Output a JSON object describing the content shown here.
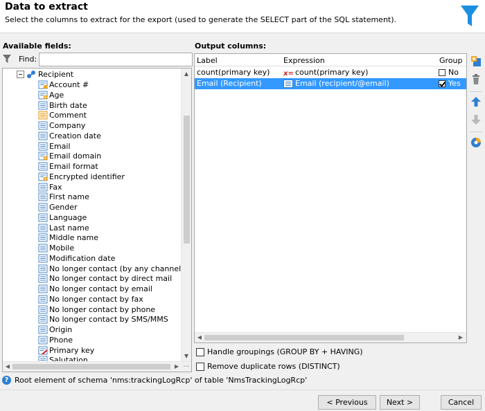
{
  "header": {
    "title": "Data to extract",
    "subtitle": "Select the columns to extract for the export (used to generate the SELECT part of the SQL statement).",
    "icon": "funnel-icon",
    "accent": "#1a8fe0"
  },
  "left": {
    "label": "Available fields:",
    "find_label": "Find:",
    "find_value": "",
    "root": "Recipient",
    "items": [
      {
        "label": "Account #",
        "icon": "key-field-icon"
      },
      {
        "label": "Age",
        "icon": "computed-field-icon"
      },
      {
        "label": "Birth date",
        "icon": "field-icon"
      },
      {
        "label": "Comment",
        "icon": "memo-field-icon"
      },
      {
        "label": "Company",
        "icon": "field-icon"
      },
      {
        "label": "Creation date",
        "icon": "field-icon"
      },
      {
        "label": "Email",
        "icon": "field-icon"
      },
      {
        "label": "Email domain",
        "icon": "computed-field-icon"
      },
      {
        "label": "Email format",
        "icon": "field-icon"
      },
      {
        "label": "Encrypted identifier",
        "icon": "computed-field-icon"
      },
      {
        "label": "Fax",
        "icon": "field-icon"
      },
      {
        "label": "First name",
        "icon": "field-icon"
      },
      {
        "label": "Gender",
        "icon": "field-icon"
      },
      {
        "label": "Language",
        "icon": "field-icon"
      },
      {
        "label": "Last name",
        "icon": "field-icon"
      },
      {
        "label": "Middle name",
        "icon": "field-icon"
      },
      {
        "label": "Mobile",
        "icon": "field-icon"
      },
      {
        "label": "Modification date",
        "icon": "field-icon"
      },
      {
        "label": "No longer contact (by any channel)",
        "icon": "field-icon"
      },
      {
        "label": "No longer contact by direct mail",
        "icon": "field-icon"
      },
      {
        "label": "No longer contact by email",
        "icon": "field-icon"
      },
      {
        "label": "No longer contact by fax",
        "icon": "field-icon"
      },
      {
        "label": "No longer contact by phone",
        "icon": "field-icon"
      },
      {
        "label": "No longer contact by SMS/MMS",
        "icon": "field-icon"
      },
      {
        "label": "Origin",
        "icon": "field-icon"
      },
      {
        "label": "Phone",
        "icon": "field-icon"
      },
      {
        "label": "Primary key",
        "icon": "primary-key-icon"
      },
      {
        "label": "Salutation",
        "icon": "field-icon"
      }
    ]
  },
  "right": {
    "label": "Output columns:",
    "columns": [
      "Label",
      "Expression",
      "Group"
    ],
    "rows": [
      {
        "label": "count(primary key)",
        "expression": "count(primary key)",
        "group": "No",
        "group_checked": false,
        "selected": false,
        "expr_icon": "function-icon"
      },
      {
        "label": "Email (Recipient)",
        "expression": "Email (recipient/@email)",
        "group": "Yes",
        "group_checked": true,
        "selected": true,
        "expr_icon": "field-icon"
      }
    ],
    "selection_color": "#3399ff"
  },
  "toolbar": [
    "add-icon",
    "delete-icon",
    "move-up-icon",
    "move-down-icon",
    "distribution-icon"
  ],
  "options": {
    "groupings": "Handle groupings (GROUP BY + HAVING)",
    "distinct": "Remove duplicate rows (DISTINCT)"
  },
  "status": {
    "text": "Root element of schema 'nms:trackingLogRcp' of table 'NmsTrackingLogRcp'"
  },
  "footer": {
    "previous": "< Previous",
    "next": "Next >",
    "cancel": "Cancel"
  }
}
